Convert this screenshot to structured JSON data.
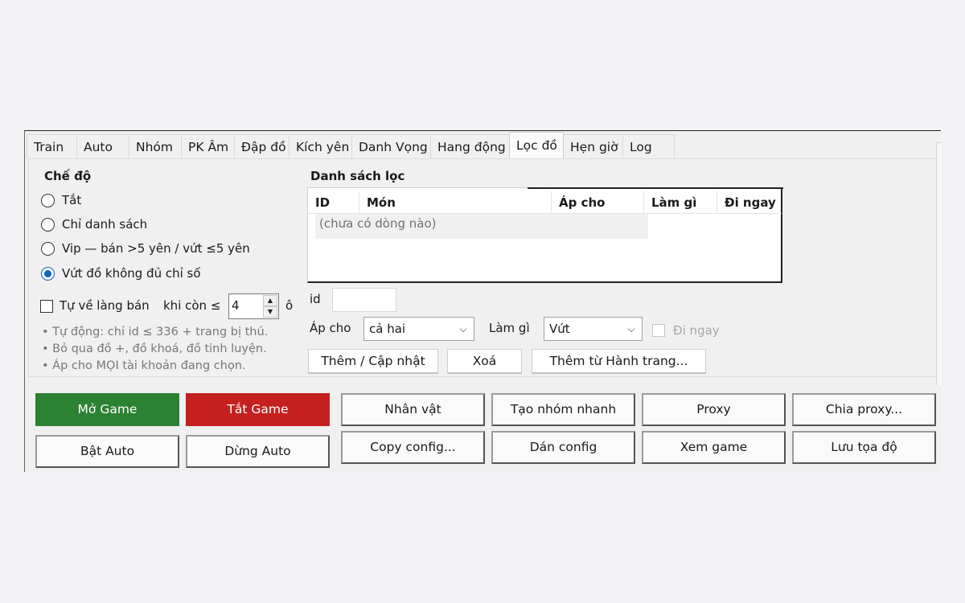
{
  "tabs": [
    "Train",
    "Auto",
    "Nhóm",
    "PK Âm",
    "Đập đồ",
    "Kích yên",
    "Danh Vọng",
    "Hang động",
    "Lọc đồ",
    "Hẹn giờ",
    "Log"
  ],
  "active_tab": "Lọc đồ",
  "mode": {
    "title": "Chế độ",
    "options": [
      "Tắt",
      "Chỉ danh sách",
      "Vip — bán >5 yên / vứt ≤5 yên",
      "Vứt đồ không đủ chỉ số"
    ],
    "selected_index": 3
  },
  "auto_return": {
    "label": "Tự về làng bán",
    "checked": false,
    "when_label": "khi còn ≤",
    "value": "4",
    "unit": "ô"
  },
  "notes": [
    "• Tự động: chỉ id ≤ 336 + trang bị thú.",
    "• Bỏ qua đồ +, đồ khoá, đồ tinh luyện.",
    "• Áp cho MỌI tài khoản đang chọn."
  ],
  "filter_list": {
    "title": "Danh sách lọc",
    "columns": [
      "ID",
      "Món",
      "Áp cho",
      "Làm gì",
      "Đi ngay"
    ],
    "empty_text": "(chưa có dòng nào)"
  },
  "form": {
    "id_label": "id",
    "id_value": "",
    "apply_label": "Áp cho",
    "apply_value": "cả hai",
    "action_label": "Làm gì",
    "action_value": "Vứt",
    "go_now_label": "Đi ngay",
    "go_now_checked": false
  },
  "list_buttons": {
    "add_update": "Thêm / Cập nhật",
    "delete": "Xoá",
    "add_from_bag": "Thêm từ Hành trang..."
  },
  "bottom_buttons": {
    "open_game": "Mở Game",
    "close_game": "Tắt Game",
    "start_auto": "Bật Auto",
    "stop_auto": "Dừng Auto",
    "character": "Nhân vật",
    "quick_group": "Tạo nhóm nhanh",
    "proxy": "Proxy",
    "split_proxy": "Chia proxy...",
    "copy_config": "Copy config...",
    "paste_config": "Dán config",
    "view_game": "Xem game",
    "save_coords": "Lưu tọa độ"
  },
  "colors": {
    "open_game_bg": "#2b8233",
    "close_game_bg": "#c42020",
    "radio_selected": "#0a63c6"
  }
}
